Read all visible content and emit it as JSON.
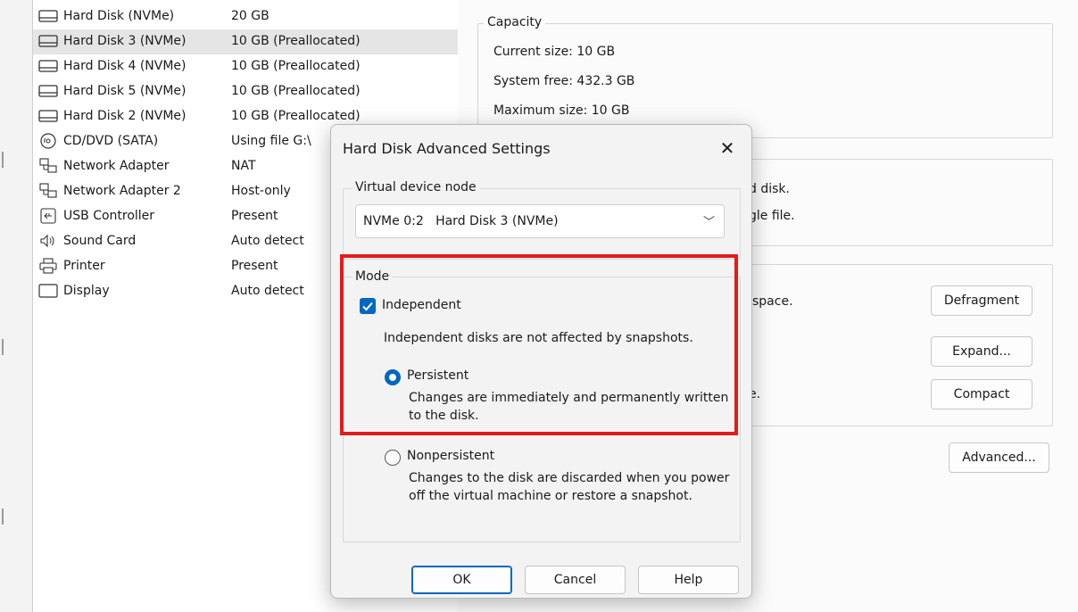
{
  "devices": [
    {
      "name": "Hard Disk (NVMe)",
      "summary": "20 GB",
      "icon": "hard-disk-icon",
      "selected": false
    },
    {
      "name": "Hard Disk 3 (NVMe)",
      "summary": "10 GB (Preallocated)",
      "icon": "hard-disk-icon",
      "selected": true
    },
    {
      "name": "Hard Disk 4 (NVMe)",
      "summary": "10 GB (Preallocated)",
      "icon": "hard-disk-icon",
      "selected": false
    },
    {
      "name": "Hard Disk 5 (NVMe)",
      "summary": "10 GB (Preallocated)",
      "icon": "hard-disk-icon",
      "selected": false
    },
    {
      "name": "Hard Disk 2 (NVMe)",
      "summary": "10 GB (Preallocated)",
      "icon": "hard-disk-icon",
      "selected": false
    },
    {
      "name": "CD/DVD (SATA)",
      "summary": "Using file G:\\",
      "icon": "cd-dvd-icon",
      "selected": false
    },
    {
      "name": "Network Adapter",
      "summary": "NAT",
      "icon": "network-adapter-icon",
      "selected": false
    },
    {
      "name": "Network Adapter 2",
      "summary": "Host-only",
      "icon": "network-adapter-icon",
      "selected": false
    },
    {
      "name": "USB Controller",
      "summary": "Present",
      "icon": "usb-icon",
      "selected": false
    },
    {
      "name": "Sound Card",
      "summary": "Auto detect",
      "icon": "speaker-icon",
      "selected": false
    },
    {
      "name": "Printer",
      "summary": "Present",
      "icon": "printer-icon",
      "selected": false
    },
    {
      "name": "Display",
      "summary": "Auto detect",
      "icon": "display-icon",
      "selected": false
    }
  ],
  "capacity": {
    "label": "Capacity",
    "current_size": "Current size: 10 GB",
    "system_free": "System free: 432.3 GB",
    "maximum_size": "Maximum size: 10 GB"
  },
  "disk_info": {
    "line1": "d disk.",
    "line2": "gle file."
  },
  "disk_utilities": {
    "text1": "space.",
    "text2": "e.",
    "defragment_label": "Defragment",
    "expand_label": "Expand...",
    "compact_label": "Compact",
    "advanced_label": "Advanced..."
  },
  "dialog": {
    "title": "Hard Disk Advanced Settings",
    "close_glyph": "✕",
    "node_group_label": "Virtual device node",
    "node_value": "NVMe 0:2   Hard Disk 3 (NVMe)",
    "mode_label": "Mode",
    "independent_label": "Independent",
    "independent_checked": true,
    "independent_note": "Independent disks are not affected by snapshots.",
    "persistent_label": "Persistent",
    "persistent_selected": true,
    "persistent_desc": "Changes are immediately and permanently written to the disk.",
    "nonpersistent_label": "Nonpersistent",
    "nonpersistent_selected": false,
    "nonpersistent_desc": "Changes to the disk are discarded when you power off the virtual machine or restore a snapshot.",
    "ok_label": "OK",
    "cancel_label": "Cancel",
    "help_label": "Help"
  },
  "colors": {
    "accent": "#0067c0",
    "highlight": "#e31b1b"
  }
}
